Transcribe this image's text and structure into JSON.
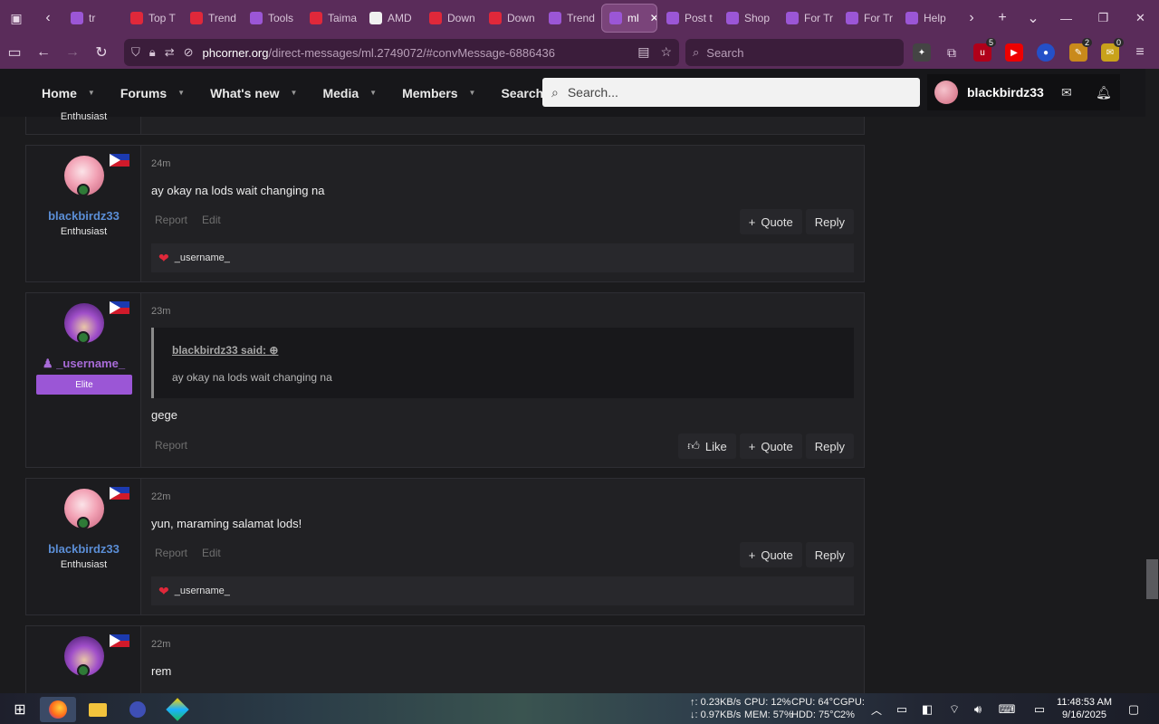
{
  "browser": {
    "tabs": [
      {
        "label": "tr",
        "color": "#9b56d6"
      },
      {
        "label": "Top T",
        "color": "#e0283a"
      },
      {
        "label": "Trend",
        "color": "#e0283a"
      },
      {
        "label": "Tools",
        "color": "#9b56d6"
      },
      {
        "label": "Taima",
        "color": "#e0283a"
      },
      {
        "label": "AMD",
        "color": "#f0f0f0"
      },
      {
        "label": "Down",
        "color": "#e0283a"
      },
      {
        "label": "Down",
        "color": "#e0283a"
      },
      {
        "label": "Trend",
        "color": "#9b56d6"
      },
      {
        "label": "ml",
        "color": "#9b56d6",
        "active": true
      },
      {
        "label": "Post t",
        "color": "#9b56d6"
      },
      {
        "label": "Shop",
        "color": "#9b56d6"
      },
      {
        "label": "For Tr",
        "color": "#9b56d6"
      },
      {
        "label": "For Tr",
        "color": "#9b56d6"
      },
      {
        "label": "Help",
        "color": "#9b56d6"
      }
    ],
    "url_host": "phcorner.org",
    "url_path": "/direct-messages/ml.2749072/#convMessage-6886436",
    "search_placeholder": "Search",
    "ext_badges": {
      "b1": "5",
      "b2": "2",
      "b3": "0"
    }
  },
  "site": {
    "nav": [
      "Home",
      "Forums",
      "What's new",
      "Media",
      "Members",
      "Search"
    ],
    "search_placeholder": "Search...",
    "username": "blackbirdz33",
    "prev_rank": "Enthusiast"
  },
  "messages": [
    {
      "time": "24m",
      "author": "blackbirdz33",
      "rank": "Enthusiast",
      "text": "ay okay na lods wait changing na",
      "left_actions": [
        "Report",
        "Edit"
      ],
      "right_actions": [
        "Quote",
        "Reply"
      ],
      "reaction": "_username_"
    },
    {
      "time": "23m",
      "author": "_username_",
      "rank": "Elite",
      "quote_header": "blackbirdz33 said:",
      "quote_text": "ay okay na lods wait changing na",
      "text": "gege",
      "left_actions": [
        "Report"
      ],
      "right_actions": [
        "Like",
        "Quote",
        "Reply"
      ]
    },
    {
      "time": "22m",
      "author": "blackbirdz33",
      "rank": "Enthusiast",
      "text": "yun, maraming salamat lods!",
      "left_actions": [
        "Report",
        "Edit"
      ],
      "right_actions": [
        "Quote",
        "Reply"
      ],
      "reaction": "_username_"
    },
    {
      "time": "22m",
      "text": "rem"
    }
  ],
  "taskbar": {
    "net_up": "↑: 0.23KB/s",
    "net_down": "↓: 0.97KB/s",
    "cpu": "CPU: 12%",
    "cpu_temp": "CPU: 64°C",
    "gpu": "GPU:",
    "mem": "MEM: 57%",
    "hdd": "HDD: 75°C",
    "gpu_val": "2%",
    "time": "11:48:53 AM",
    "date": "9/16/2025"
  }
}
